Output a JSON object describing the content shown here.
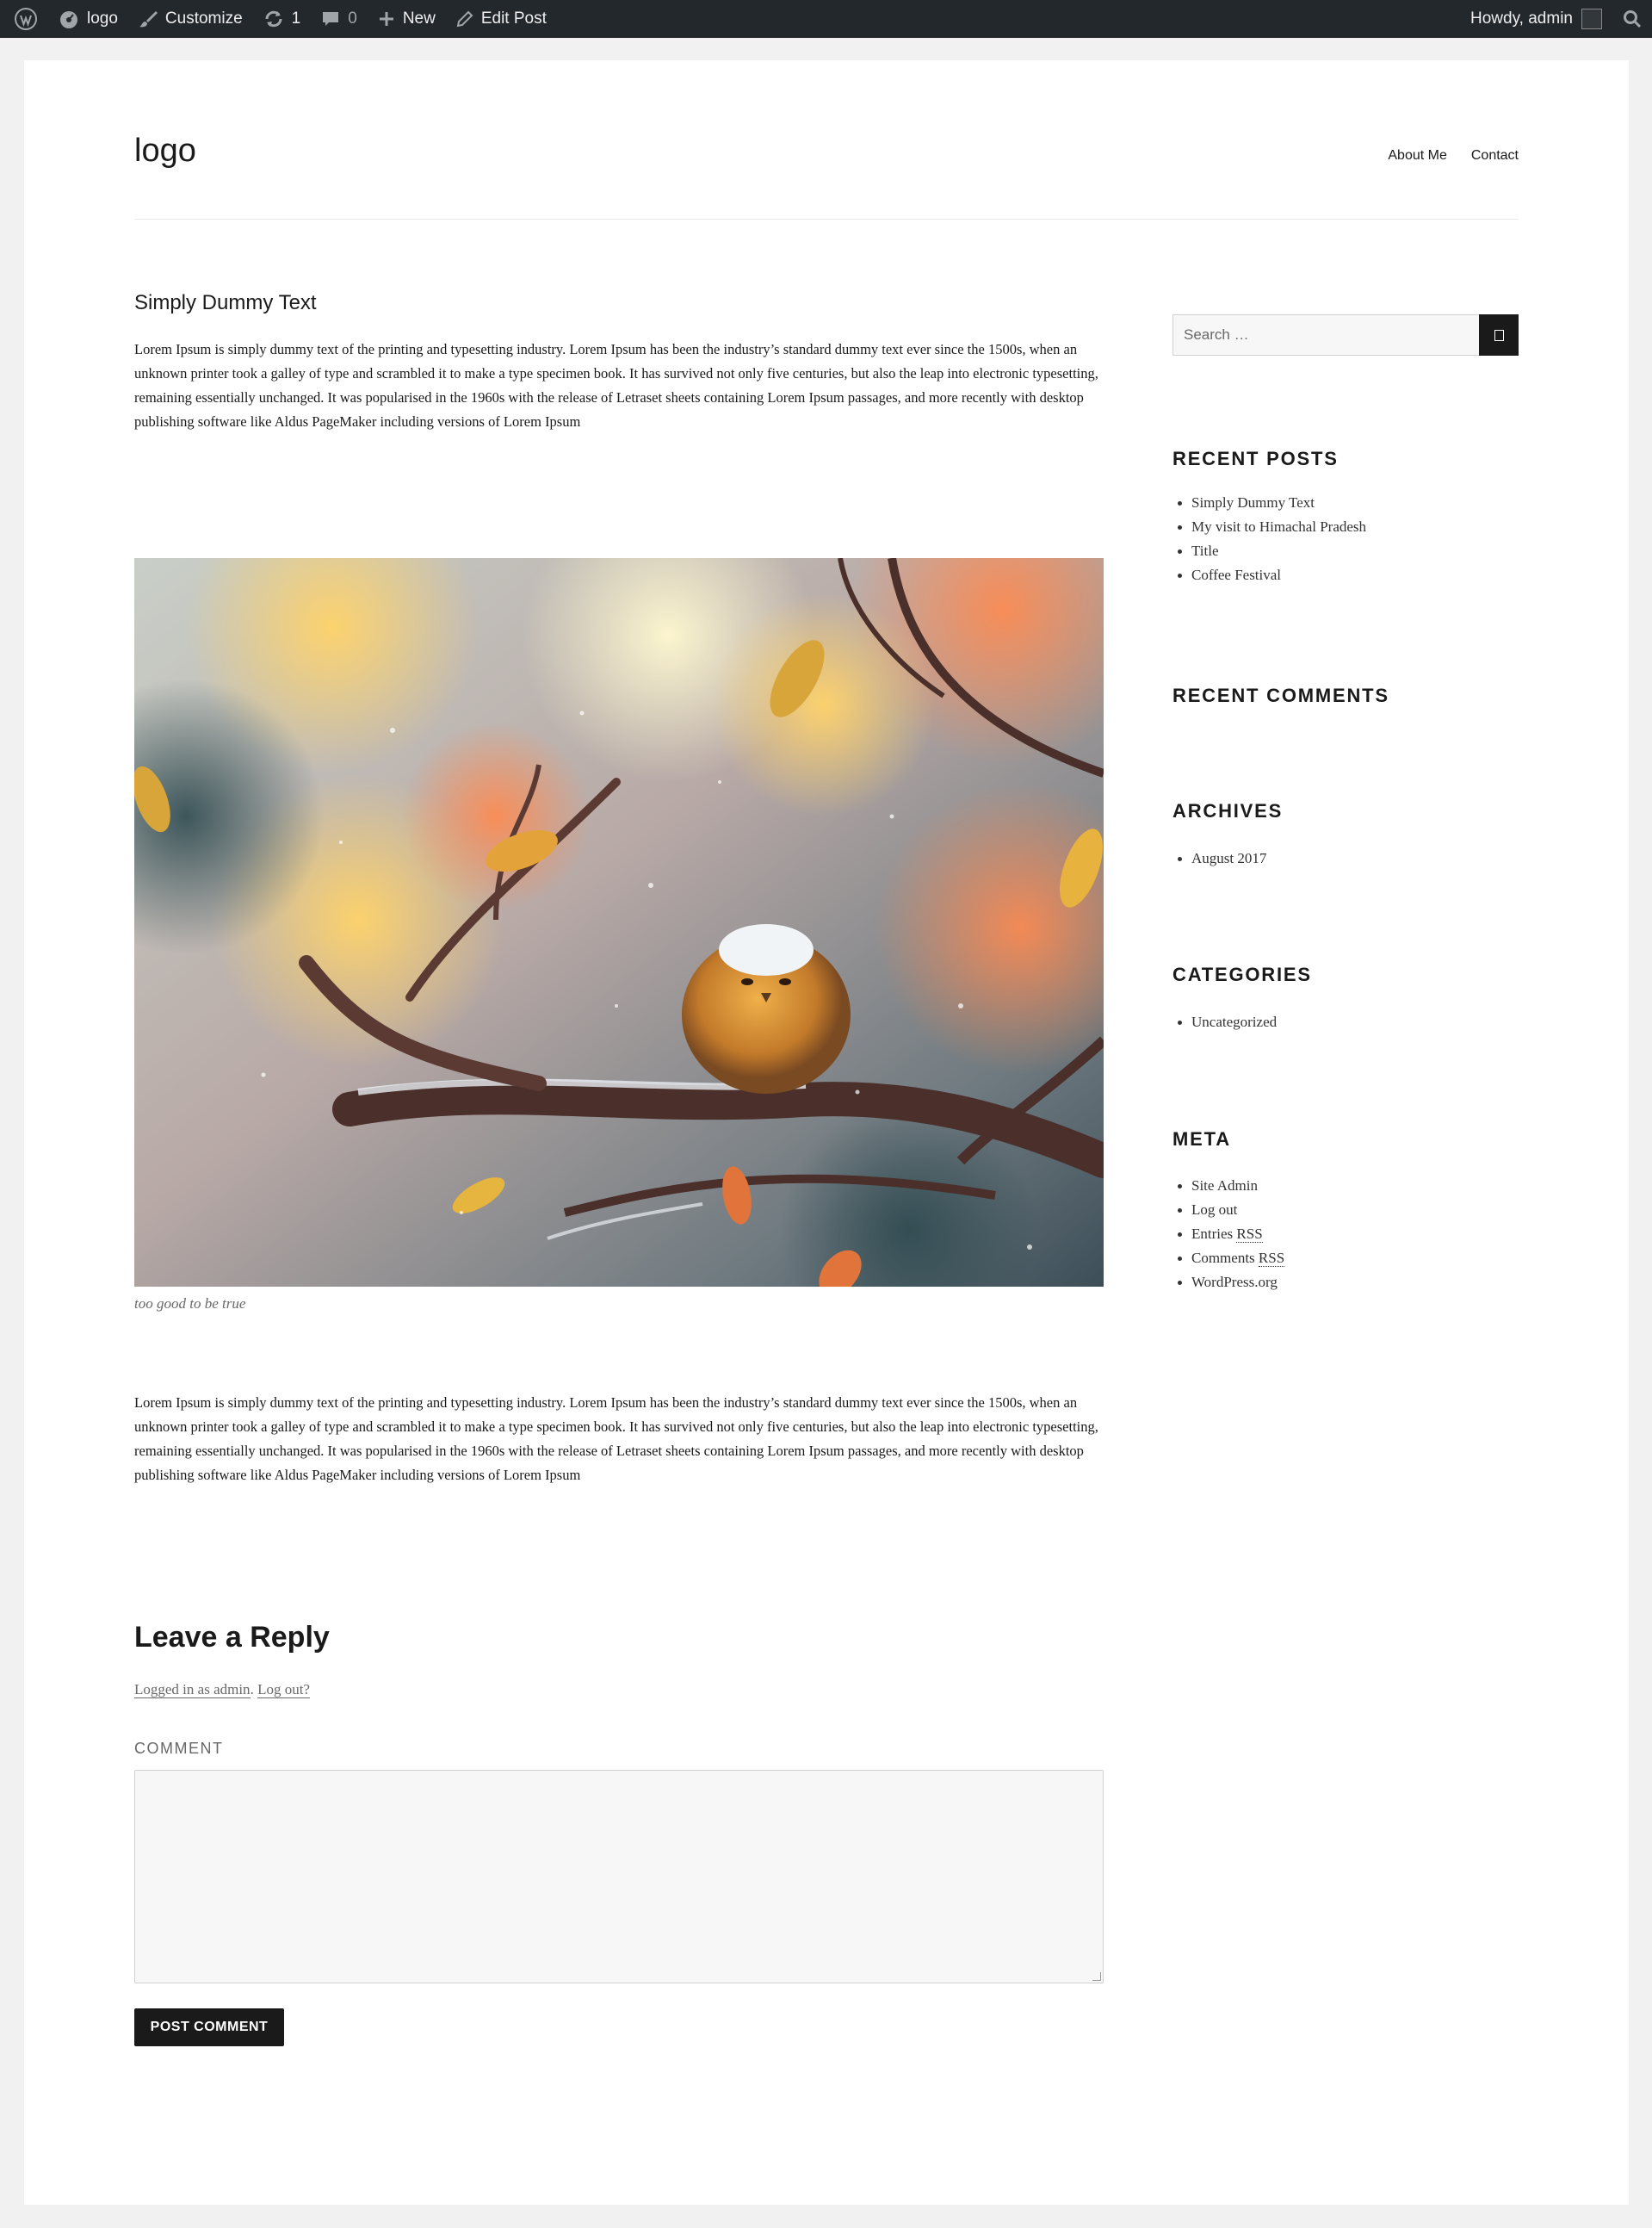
{
  "admin_bar": {
    "site_label": "logo",
    "customize_label": "Customize",
    "updates_count": "1",
    "comments_count": "0",
    "new_label": "New",
    "edit_label": "Edit Post",
    "howdy": "Howdy, admin"
  },
  "header": {
    "site_title": "logo",
    "menu": [
      "About Me",
      "Contact"
    ]
  },
  "post": {
    "title": "Simply Dummy Text",
    "para1": "Lorem Ipsum is simply dummy text of the printing and typesetting industry. Lorem Ipsum has been the industry’s standard dummy text ever since the 1500s, when an unknown printer took a galley of type and scrambled it to make a type specimen book. It has survived not only five centuries, but also the leap into electronic typesetting, remaining essentially unchanged. It was popularised in the 1960s with the release of Letraset sheets containing Lorem Ipsum passages, and more recently with desktop publishing software like Aldus PageMaker including versions of Lorem Ipsum",
    "caption": "too good to be true",
    "para2": "Lorem Ipsum is simply dummy text of the printing and typesetting industry. Lorem Ipsum has been the industry’s standard dummy text ever since the 1500s, when an unknown printer took a galley of type and scrambled it to make a type specimen book. It has survived not only five centuries, but also the leap into electronic typesetting, remaining essentially unchanged. It was popularised in the 1960s with the release of Letraset sheets containing Lorem Ipsum passages, and more recently with desktop publishing software like Aldus PageMaker including versions of Lorem Ipsum"
  },
  "reply": {
    "title": "Leave a Reply",
    "logged_in": "Logged in as admin",
    "separator": ". ",
    "logout": "Log out?",
    "comment_label": "COMMENT",
    "submit": "POST COMMENT"
  },
  "sidebar": {
    "search_placeholder": "Search …",
    "recent_posts_title": "RECENT POSTS",
    "recent_posts": [
      "Simply Dummy Text",
      "My visit to Himachal Pradesh",
      "Title",
      "Coffee Festival"
    ],
    "recent_comments_title": "RECENT COMMENTS",
    "archives_title": "ARCHIVES",
    "archives": [
      "August 2017"
    ],
    "categories_title": "CATEGORIES",
    "categories": [
      "Uncategorized"
    ],
    "meta_title": "META",
    "meta": {
      "site_admin": "Site Admin",
      "log_out": "Log out",
      "entries": "Entries",
      "comments": "Comments",
      "rss": "RSS",
      "wordpress": "WordPress.org"
    }
  },
  "colors": {
    "admin_bar_bg": "#23282d",
    "text": "#1a1a1a",
    "muted": "#686868",
    "button_bg": "#1a1a1a"
  },
  "icons": [
    "wordpress-icon",
    "dashboard-icon",
    "brush-icon",
    "update-icon",
    "comment-icon",
    "plus-icon",
    "pencil-icon",
    "search-icon"
  ]
}
